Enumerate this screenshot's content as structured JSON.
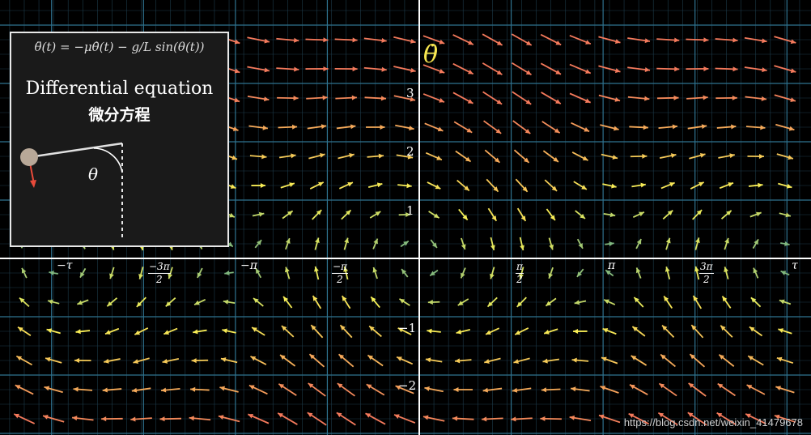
{
  "inset": {
    "equation": "θ̈(t) = −μθ̇(t) − g/L sin(θ(t))",
    "title_en": "Differential equation",
    "title_zh": "微分方程",
    "angle_label": "θ"
  },
  "axes": {
    "y_axis_symbol": "θ̇",
    "y_ticks": [
      "3",
      "2",
      "1",
      "−1",
      "−2"
    ],
    "x_ticks": {
      "neg_tau": "−τ",
      "neg_3pi_over_2": {
        "num": "−3π",
        "den": "2"
      },
      "neg_pi": "−π",
      "neg_pi_over_2": {
        "num": "−π",
        "den": "2"
      },
      "pi_over_2": {
        "num": "π",
        "den": "2"
      },
      "pi": "π",
      "three_pi_over_2": {
        "num": "3π",
        "den": "2"
      },
      "tau": "τ"
    }
  },
  "field": {
    "mu": 0.3,
    "g_over_L": 1.0,
    "colors": {
      "slow": "#5fa88a",
      "mid": "#f7f056",
      "fast": "#f57a5c"
    }
  },
  "watermark": "https://blog.csdn.net/weixin_41479678"
}
